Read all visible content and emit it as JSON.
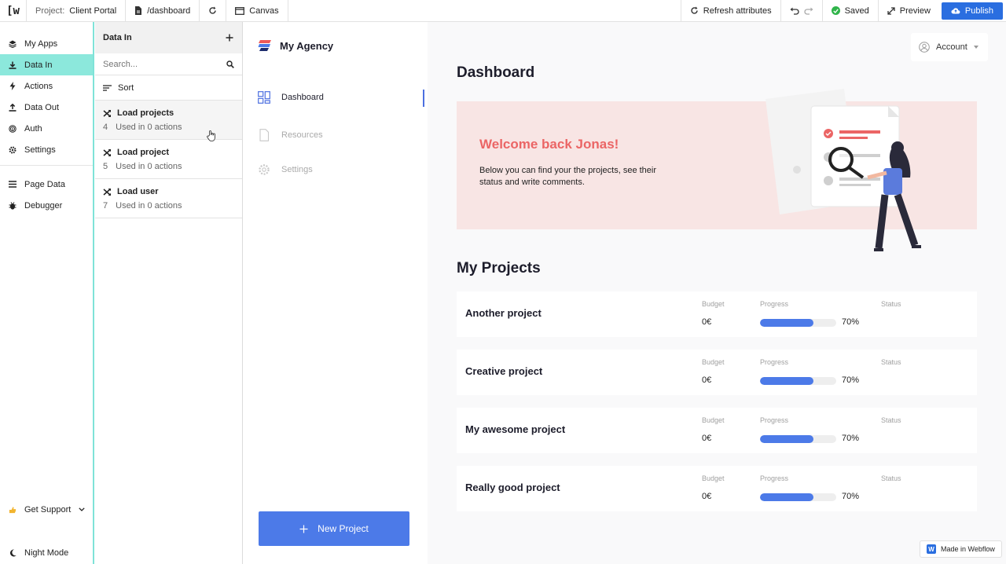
{
  "topbar": {
    "logo": "[w",
    "project_label": "Project:",
    "project_name": "Client Portal",
    "path": "/dashboard",
    "canvas_label": "Canvas",
    "refresh_label": "Refresh attributes",
    "saved_label": "Saved",
    "preview_label": "Preview",
    "publish_label": "Publish"
  },
  "leftnav": {
    "items": [
      {
        "label": "My Apps",
        "icon": "layers-icon"
      },
      {
        "label": "Data In",
        "icon": "download-icon",
        "active": true
      },
      {
        "label": "Actions",
        "icon": "bolt-icon"
      },
      {
        "label": "Data Out",
        "icon": "upload-icon"
      },
      {
        "label": "Auth",
        "icon": "fingerprint-icon"
      },
      {
        "label": "Settings",
        "icon": "gear-icon"
      }
    ],
    "items2": [
      {
        "label": "Page Data",
        "icon": "list-icon"
      },
      {
        "label": "Debugger",
        "icon": "bug-icon"
      }
    ],
    "support_label": "Get Support",
    "night_mode_label": "Night Mode"
  },
  "panel": {
    "title": "Data In",
    "search_placeholder": "Search...",
    "sort_label": "Sort",
    "items": [
      {
        "title": "Load projects",
        "id": "4",
        "used": "Used in 0 actions"
      },
      {
        "title": "Load project",
        "id": "5",
        "used": "Used in 0 actions"
      },
      {
        "title": "Load user",
        "id": "7",
        "used": "Used in 0 actions"
      }
    ]
  },
  "sitenav": {
    "brand": "My Agency",
    "items": [
      {
        "label": "Dashboard",
        "icon": "grid-icon"
      },
      {
        "label": "Resources",
        "icon": "file-icon"
      },
      {
        "label": "Settings",
        "icon": "gear-icon"
      }
    ],
    "new_project_label": "New Project"
  },
  "main": {
    "account_label": "Account",
    "dashboard_title": "Dashboard",
    "hero_title": "Welcome back Jonas!",
    "hero_text": "Below you can find your the projects, see their status and write comments.",
    "projects_title": "My Projects",
    "col_budget": "Budget",
    "col_progress": "Progress",
    "col_status": "Status",
    "projects": [
      {
        "name": "Another project",
        "budget": "0€",
        "progress": 70,
        "progress_label": "70%"
      },
      {
        "name": "Creative project",
        "budget": "0€",
        "progress": 70,
        "progress_label": "70%"
      },
      {
        "name": "My awesome project",
        "budget": "0€",
        "progress": 70,
        "progress_label": "70%"
      },
      {
        "name": "Really good project",
        "budget": "0€",
        "progress": 70,
        "progress_label": "70%"
      }
    ],
    "badge_label": "Made in Webflow"
  },
  "colors": {
    "accent": "#2a6ee0",
    "nav_active": "#8ce8dc",
    "hero_bg": "#f8e5e4",
    "hero_title": "#eb6565",
    "progress_fill": "#4c7ae8"
  }
}
